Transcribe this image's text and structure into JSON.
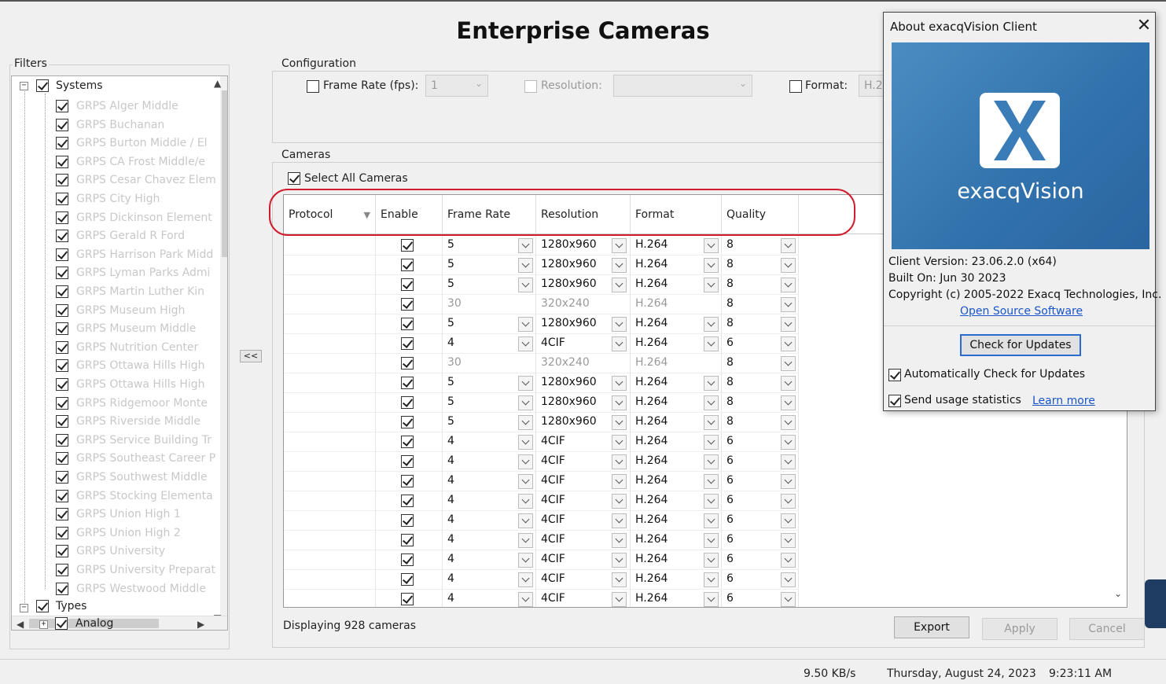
{
  "page": {
    "title": "Enterprise Cameras"
  },
  "filters": {
    "legend": "Filters",
    "systems_label": "Systems",
    "systems": [
      "GRPS Alger Middle",
      "GRPS Buchanan",
      "GRPS Burton Middle / El",
      "GRPS CA Frost Middle/e",
      "GRPS Cesar Chavez Elem",
      "GRPS City High",
      "GRPS Dickinson Element",
      "GRPS Gerald R Ford",
      "GRPS Harrison Park Midd",
      "GRPS Lyman Parks Admi",
      "GRPS Martin Luther Kin",
      "GRPS Museum High",
      "GRPS Museum Middle",
      "GRPS Nutrition Center",
      "GRPS Ottawa Hills High",
      "GRPS Ottawa Hills High",
      "GRPS Ridgemoor Monte",
      "GRPS Riverside Middle",
      "GRPS Service Building Tr",
      "GRPS Southeast Career P",
      "GRPS Southwest Middle",
      "GRPS Stocking Elementa",
      "GRPS Union High 1",
      "GRPS Union High 2",
      "GRPS University",
      "GRPS University Preparat",
      "GRPS Westwood Middle"
    ],
    "types_label": "Types",
    "analog_label": "Analog",
    "collapse_button": "<<"
  },
  "configuration": {
    "legend": "Configuration",
    "frame_rate_label": "Frame Rate (fps):",
    "frame_rate_value": "1",
    "resolution_label": "Resolution:",
    "resolution_value": "",
    "format_label": "Format:",
    "format_value": "H.2"
  },
  "cameras": {
    "legend": "Cameras",
    "select_all_label": "Select All Cameras",
    "columns": [
      "Protocol",
      "Enable",
      "Frame Rate",
      "Resolution",
      "Format",
      "Quality"
    ],
    "rows": [
      {
        "fps": "5",
        "res": "1280x960",
        "fmt": "H.264",
        "q": "8",
        "ro": false
      },
      {
        "fps": "5",
        "res": "1280x960",
        "fmt": "H.264",
        "q": "8",
        "ro": false
      },
      {
        "fps": "5",
        "res": "1280x960",
        "fmt": "H.264",
        "q": "8",
        "ro": false
      },
      {
        "fps": "30",
        "res": "320x240",
        "fmt": "H.264",
        "q": "8",
        "ro": true
      },
      {
        "fps": "5",
        "res": "1280x960",
        "fmt": "H.264",
        "q": "8",
        "ro": false
      },
      {
        "fps": "4",
        "res": "4CIF",
        "fmt": "H.264",
        "q": "6",
        "ro": false
      },
      {
        "fps": "30",
        "res": "320x240",
        "fmt": "H.264",
        "q": "8",
        "ro": true
      },
      {
        "fps": "5",
        "res": "1280x960",
        "fmt": "H.264",
        "q": "8",
        "ro": false
      },
      {
        "fps": "5",
        "res": "1280x960",
        "fmt": "H.264",
        "q": "8",
        "ro": false
      },
      {
        "fps": "5",
        "res": "1280x960",
        "fmt": "H.264",
        "q": "8",
        "ro": false
      },
      {
        "fps": "4",
        "res": "4CIF",
        "fmt": "H.264",
        "q": "6",
        "ro": false
      },
      {
        "fps": "4",
        "res": "4CIF",
        "fmt": "H.264",
        "q": "6",
        "ro": false
      },
      {
        "fps": "4",
        "res": "4CIF",
        "fmt": "H.264",
        "q": "6",
        "ro": false
      },
      {
        "fps": "4",
        "res": "4CIF",
        "fmt": "H.264",
        "q": "6",
        "ro": false
      },
      {
        "fps": "4",
        "res": "4CIF",
        "fmt": "H.264",
        "q": "6",
        "ro": false
      },
      {
        "fps": "4",
        "res": "4CIF",
        "fmt": "H.264",
        "q": "6",
        "ro": false
      },
      {
        "fps": "4",
        "res": "4CIF",
        "fmt": "H.264",
        "q": "6",
        "ro": false
      },
      {
        "fps": "4",
        "res": "4CIF",
        "fmt": "H.264",
        "q": "6",
        "ro": false
      },
      {
        "fps": "4",
        "res": "4CIF",
        "fmt": "H.264",
        "q": "6",
        "ro": false
      }
    ],
    "display_count": "Displaying 928 cameras",
    "export_label": "Export",
    "apply_label": "Apply",
    "cancel_label": "Cancel"
  },
  "statusbar": {
    "rate": "9.50 KB/s",
    "date": "Thursday, August 24, 2023",
    "time": "9:23:11 AM"
  },
  "about": {
    "title": "About exacqVision Client",
    "logo_text": "exacqVision",
    "version": "Client Version: 23.06.2.0 (x64)",
    "built": "Built On: Jun 30 2023",
    "copyright": "Copyright (c) 2005-2022 Exacq Technologies, Inc.",
    "open_source_link": "Open Source Software",
    "check_updates_label": "Check for Updates",
    "auto_check_label": "Automatically Check for Updates",
    "usage_stats_label": "Send usage statistics",
    "learn_more_link": "Learn more",
    "brand_color": "#3a7cb8",
    "annotation_color": "#d01c2c"
  }
}
